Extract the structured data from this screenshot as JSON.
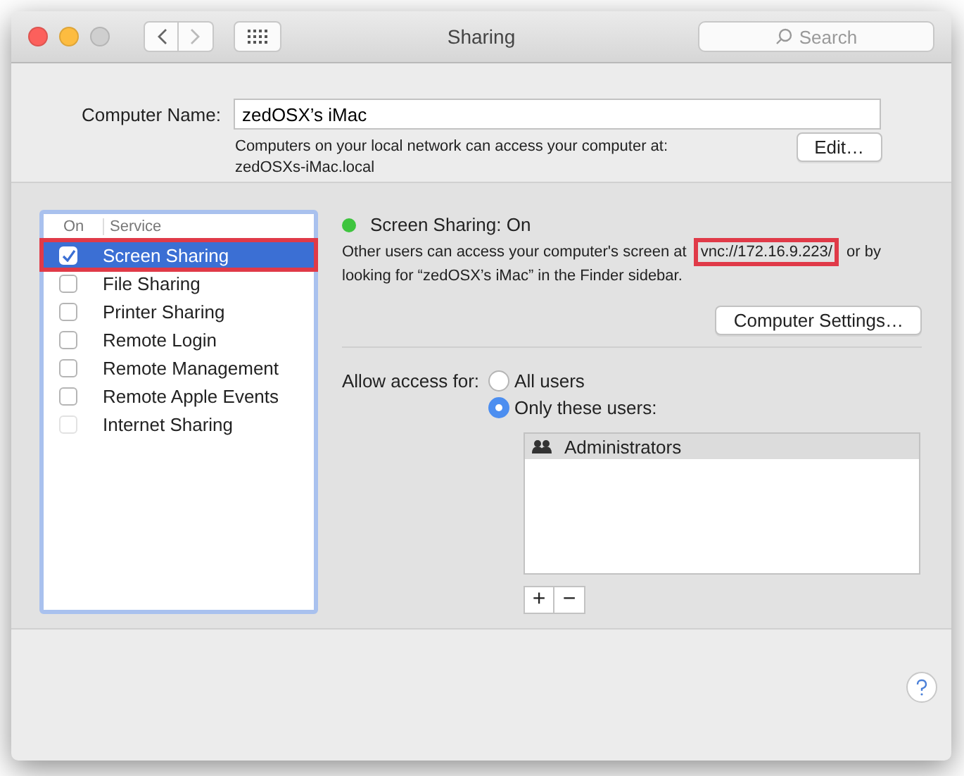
{
  "window": {
    "title": "Sharing",
    "search": {
      "placeholder": "Search"
    }
  },
  "computer_name": {
    "label": "Computer Name:",
    "value": "zedOSX’s iMac",
    "note": "Computers on your local network can access your computer at:",
    "address": "zedOSXs-iMac.local",
    "edit_button": "Edit…"
  },
  "services": {
    "columns": [
      "On",
      "Service"
    ],
    "items": [
      {
        "name": "Screen Sharing",
        "checked": true,
        "selected": true,
        "highlighted": true
      },
      {
        "name": "File Sharing",
        "checked": false,
        "selected": false,
        "highlighted": false
      },
      {
        "name": "Printer Sharing",
        "checked": false,
        "selected": false,
        "highlighted": false
      },
      {
        "name": "Remote Login",
        "checked": false,
        "selected": false,
        "highlighted": false
      },
      {
        "name": "Remote Management",
        "checked": false,
        "selected": false,
        "highlighted": false
      },
      {
        "name": "Remote Apple Events",
        "checked": false,
        "selected": false,
        "highlighted": false
      },
      {
        "name": "Internet Sharing",
        "checked": false,
        "selected": false,
        "highlighted": false,
        "disabled": true
      }
    ]
  },
  "status": {
    "text": "Screen Sharing: On",
    "color": "#3ec43e",
    "description_before": "Other users can access your computer's screen at ",
    "address": "vnc://172.16.9.223/",
    "address_highlighted": true,
    "description_after": " or by looking for “zedOSX’s iMac” in the Finder sidebar.",
    "settings_button": "Computer Settings…"
  },
  "access": {
    "label": "Allow access for:",
    "options": [
      {
        "label": "All users",
        "selected": false
      },
      {
        "label": "Only these users:",
        "selected": true
      }
    ],
    "users": [
      {
        "name": "Administrators",
        "selected": true
      }
    ],
    "add": "+",
    "remove": "−"
  }
}
